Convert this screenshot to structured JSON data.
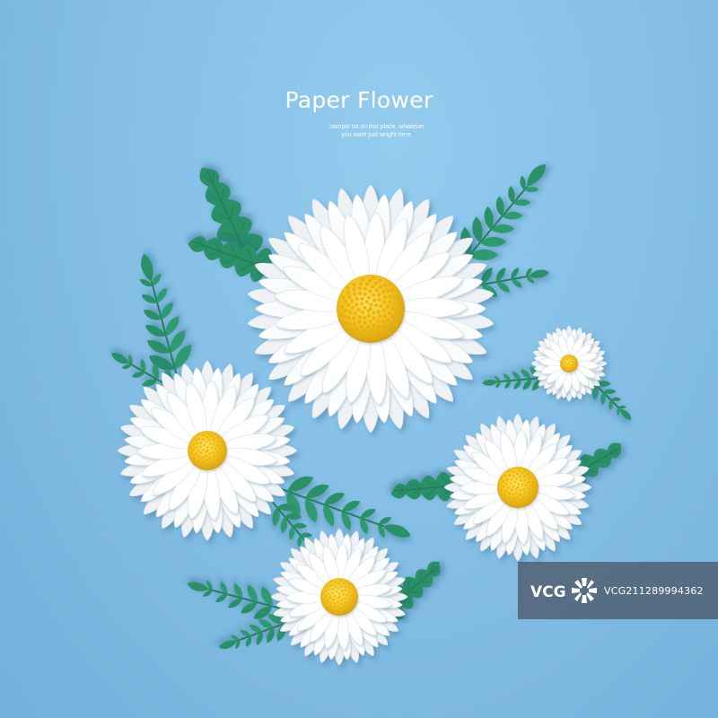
{
  "headline": {
    "title": "Paper Flower",
    "subtitle_line1": "sample txt on this place, whatever",
    "subtitle_line2": "you want just wright here."
  },
  "watermark": {
    "logo_text": "VCG",
    "id_text": "VCG211289994362"
  },
  "colors": {
    "background": "#86c0e6",
    "petal": "#ffffff",
    "center": "#f2c21f",
    "leaf": "#2a9068"
  },
  "scene": {
    "daisy_count": 5,
    "leaf_type": "paper-fern"
  }
}
